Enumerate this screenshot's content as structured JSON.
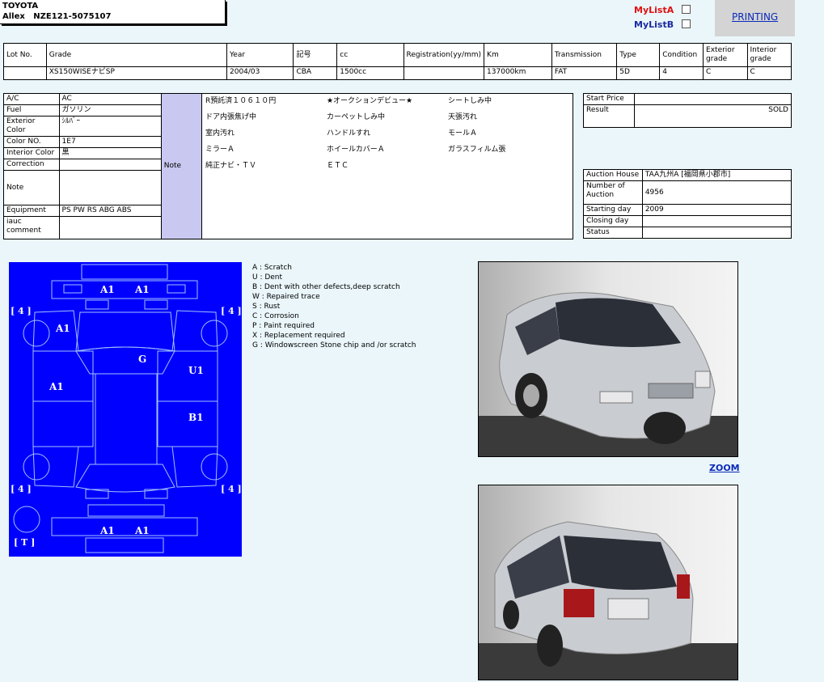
{
  "header": {
    "make": "TOYOTA",
    "model": "Allex",
    "chassis": "NZE121-5075107"
  },
  "mylist": {
    "a": "MyListA",
    "b": "MyListB",
    "a_color": "#e01010",
    "b_color": "#1a2aa0"
  },
  "printing": "PRINTING",
  "spec": {
    "headers": [
      "Lot No.",
      "Grade",
      "Year",
      "記号",
      "cc",
      "Registration(yy/mm)",
      "Km",
      "Transmission",
      "Type",
      "Condition",
      "Exterior grade",
      "Interior grade"
    ],
    "values": [
      "",
      "XS150WISEナビSP",
      "2004/03",
      "CBA",
      "1500cc",
      "",
      "137000km",
      "FAT",
      "5D",
      "4",
      "C",
      "C"
    ]
  },
  "details": {
    "ac_label": "A/C",
    "ac": "AC",
    "fuel_label": "Fuel",
    "fuel": "ガソリン",
    "ext_color_label": "Exterior Color",
    "ext_color": "ｼﾙﾊﾞｰ",
    "color_no_label": "Color NO.",
    "color_no": "1E7",
    "int_color_label": "Interior Color",
    "int_color": "黒",
    "correction_label": "Correction",
    "correction": "",
    "note_label": "Note",
    "note": "",
    "note2_label": "Note",
    "notes": [
      "R預託済１０６１０円",
      "★オークションデビュー★",
      "シートしみ中",
      "ドア内張焦げ中",
      "カーペットしみ中",
      "天張汚れ",
      "室内汚れ",
      "ハンドルすれ",
      "モールＡ",
      "ミラーＡ",
      "ホイールカバーＡ",
      "ガラスフィルム張",
      "純正ナビ・ＴＶ",
      "ＥＴＣ",
      ""
    ],
    "equipment_label": "Equipment",
    "equipment": "PS PW RS ABG ABS",
    "iauc_label": "iauc comment",
    "iauc": ""
  },
  "price": {
    "start_label": "Start Price",
    "start": "",
    "result_label": "Result",
    "result": "SOLD"
  },
  "auction": {
    "house_label": "Auction House",
    "house": "TAA九州A [福岡県小郡市]",
    "number_label": "Number of Auction",
    "number": "4956",
    "starting_label": "Starting day",
    "starting": "2009",
    "closing_label": "Closing day",
    "closing": "",
    "status_label": "Status",
    "status": ""
  },
  "diagram": {
    "background": "#0000ff",
    "marks": [
      "A1",
      "A1",
      "A1",
      "G",
      "U1",
      "A1",
      "B1",
      "A1",
      "A1"
    ],
    "tires": [
      "4",
      "4",
      "4",
      "4",
      "T"
    ]
  },
  "legend": [
    "A : Scratch",
    "U : Dent",
    "B : Dent with other defects,deep scratch",
    "W : Repaired trace",
    "S : Rust",
    "C : Corrosion",
    "P : Paint required",
    "X : Replacement required",
    "G : Windowscreen Stone chip and /or scratch"
  ],
  "zoom": "ZOOM",
  "car_color": "#c9ccd1"
}
